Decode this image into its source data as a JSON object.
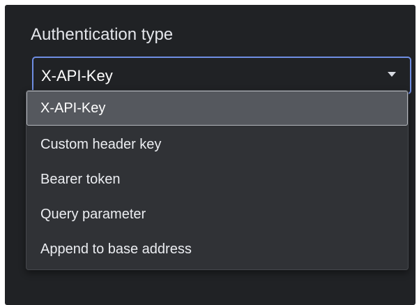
{
  "auth": {
    "label": "Authentication type",
    "selected": "X-API-Key",
    "options": [
      "X-API-Key",
      "Custom header key",
      "Bearer token",
      "Query parameter",
      "Append to base address"
    ]
  },
  "colors": {
    "panel_background": "#202225",
    "menu_background": "#303236",
    "highlight_background": "#55585e",
    "focus_border": "#6f8ee3",
    "text": "#eceef2"
  },
  "icons": {
    "dropdown_arrow": "chevron-down-icon"
  }
}
